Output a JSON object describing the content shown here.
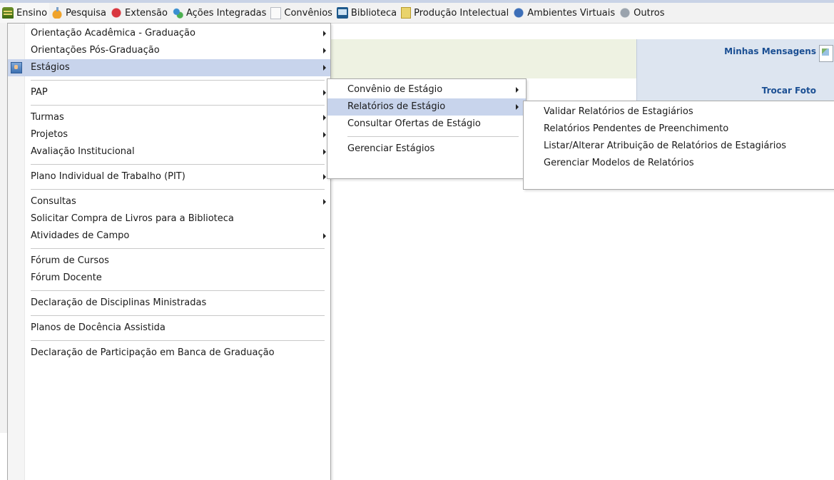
{
  "menubar": [
    {
      "label": "Ensino",
      "icon": "books-icon",
      "active": true
    },
    {
      "label": "Pesquisa",
      "icon": "flask-icon"
    },
    {
      "label": "Extensão",
      "icon": "heart-icon"
    },
    {
      "label": "Ações Integradas",
      "icon": "puzzle-icon"
    },
    {
      "label": "Convênios",
      "icon": "document-icon"
    },
    {
      "label": "Biblioteca",
      "icon": "library-icon"
    },
    {
      "label": "Produção Intelectual",
      "icon": "notepad-icon"
    },
    {
      "label": "Ambientes Virtuais",
      "icon": "network-icon"
    },
    {
      "label": "Outros",
      "icon": "gears-icon"
    }
  ],
  "menu_ensino": {
    "items": [
      {
        "label": "Orientação Acadêmica - Graduação",
        "submenu": true
      },
      {
        "label": "Orientações Pós-Graduação",
        "submenu": true
      },
      {
        "label": "Estágios",
        "submenu": true,
        "highlighted": true,
        "icon": "intern-icon"
      },
      {
        "label": "PAP",
        "submenu": true
      },
      {
        "label": "Turmas",
        "submenu": true
      },
      {
        "label": "Projetos",
        "submenu": true
      },
      {
        "label": "Avaliação Institucional",
        "submenu": true
      },
      {
        "label": "Plano Individual de Trabalho (PIT)",
        "submenu": true
      },
      {
        "label": "Consultas",
        "submenu": true
      },
      {
        "label": "Solicitar Compra de Livros para a Biblioteca",
        "submenu": false
      },
      {
        "label": "Atividades de Campo",
        "submenu": true
      },
      {
        "label": "Fórum de Cursos",
        "submenu": false
      },
      {
        "label": "Fórum Docente",
        "submenu": false
      },
      {
        "label": "Declaração de Disciplinas Ministradas",
        "submenu": false
      },
      {
        "label": "Planos de Docência Assistida",
        "submenu": false
      },
      {
        "label": "Declaração de Participação em Banca de Graduação",
        "submenu": false
      }
    ]
  },
  "menu_estagios": {
    "items": [
      {
        "label": "Convênio de Estágio",
        "submenu": true
      },
      {
        "label": "Relatórios de Estágio",
        "submenu": true,
        "highlighted": true
      },
      {
        "label": "Consultar Ofertas de Estágio",
        "submenu": false
      },
      {
        "label": "Gerenciar Estágios",
        "submenu": false
      }
    ]
  },
  "menu_relatorios": {
    "items": [
      {
        "label": "Validar Relatórios de Estagiários"
      },
      {
        "label": "Relatórios Pendentes de Preenchimento"
      },
      {
        "label": "Listar/Alterar Atribuição de Relatórios de Estagiários"
      },
      {
        "label": "Gerenciar Modelos de Relatórios"
      }
    ]
  },
  "side_panel": {
    "messages_label": "Minhas Mensagens",
    "change_photo_label": "Trocar Foto"
  },
  "colors": {
    "highlight": "#c8d4ec",
    "link": "#1b4f93",
    "panel": "#dde5f0"
  }
}
